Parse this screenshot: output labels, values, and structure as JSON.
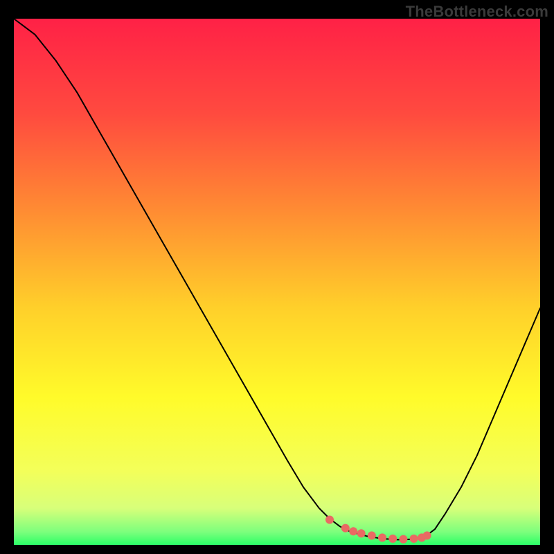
{
  "watermark": "TheBottleneck.com",
  "chart_data": {
    "type": "line",
    "title": "",
    "xlabel": "",
    "ylabel": "",
    "xlim": [
      0,
      100
    ],
    "ylim": [
      0,
      100
    ],
    "background": {
      "type": "vertical-gradient",
      "stops": [
        {
          "offset": 0.0,
          "color": "#ff2146"
        },
        {
          "offset": 0.18,
          "color": "#ff4a3f"
        },
        {
          "offset": 0.36,
          "color": "#ff8a33"
        },
        {
          "offset": 0.55,
          "color": "#ffd02a"
        },
        {
          "offset": 0.72,
          "color": "#fffb2a"
        },
        {
          "offset": 0.86,
          "color": "#f3ff5a"
        },
        {
          "offset": 0.93,
          "color": "#d8ff7a"
        },
        {
          "offset": 0.975,
          "color": "#7dff7d"
        },
        {
          "offset": 1.0,
          "color": "#2bff66"
        }
      ]
    },
    "series": [
      {
        "name": "bottleneck-curve",
        "stroke": "#000000",
        "stroke_width": 2.0,
        "x": [
          0,
          4,
          8,
          12,
          16,
          20,
          24,
          28,
          32,
          36,
          40,
          44,
          48,
          52,
          55,
          58,
          60,
          62,
          64,
          67,
          70,
          73,
          76,
          78,
          80,
          82,
          85,
          88,
          91,
          94,
          97,
          100
        ],
        "y": [
          100,
          97,
          92,
          86,
          79,
          72,
          65,
          58,
          51,
          44,
          37,
          30,
          23,
          16,
          11,
          7,
          5,
          3.5,
          2.5,
          1.7,
          1.2,
          1.0,
          1.1,
          1.5,
          3,
          6,
          11,
          17,
          24,
          31,
          38,
          45
        ]
      }
    ],
    "markers": {
      "name": "highlight-dots",
      "color": "#e96a63",
      "radius": 6,
      "x": [
        60,
        63,
        64.5,
        66,
        68,
        70,
        72,
        74,
        76,
        77.5,
        78.5
      ],
      "y": [
        4.8,
        3.2,
        2.6,
        2.2,
        1.8,
        1.4,
        1.2,
        1.1,
        1.2,
        1.4,
        1.8
      ]
    }
  }
}
